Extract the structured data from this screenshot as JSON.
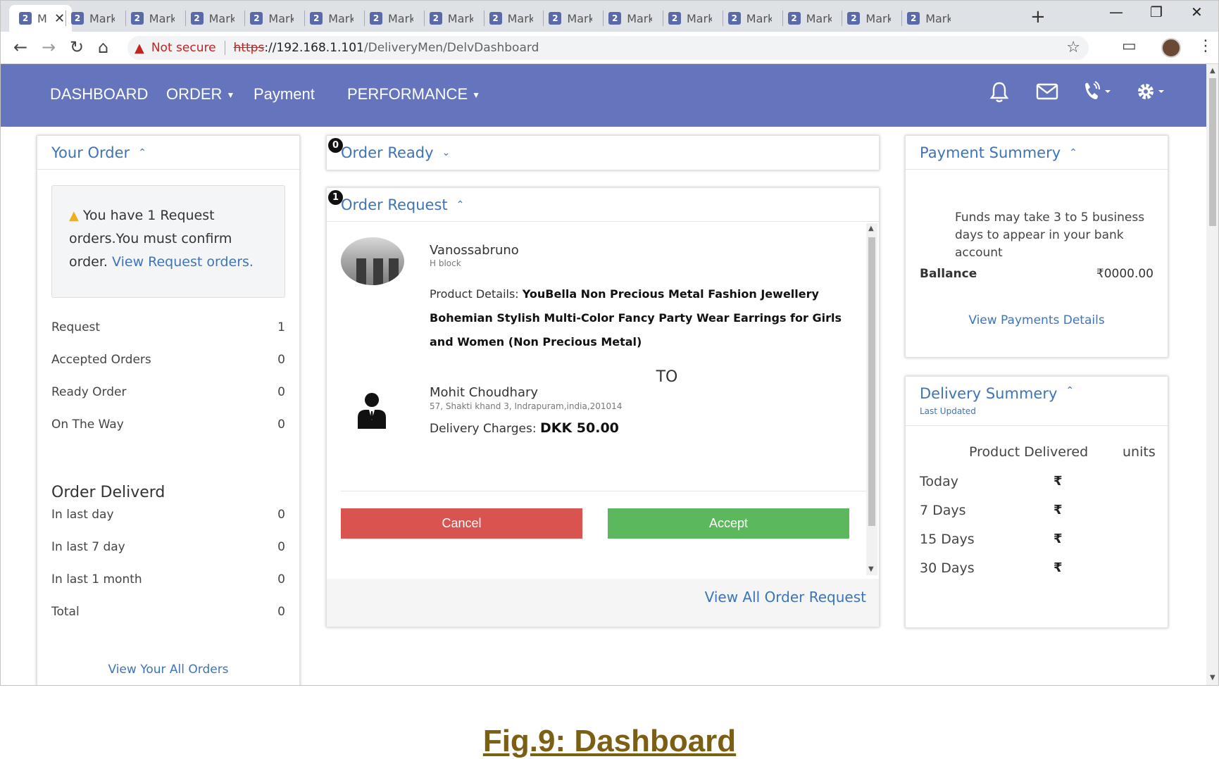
{
  "browser": {
    "active_tab": {
      "title": "M"
    },
    "tabs": [
      "Mark",
      "Mark",
      "Mark",
      "Mark",
      "Mark",
      "Mark",
      "Mark",
      "Mark",
      "Mark",
      "Mark",
      "Mark",
      "Mark",
      "Mark",
      "Mark",
      "Mark"
    ],
    "url": {
      "security_label": "Not secure",
      "scheme": "https",
      "host": "://192.168.1.101",
      "path": "/DeliveryMen/DelvDashboard"
    }
  },
  "nav": {
    "items": [
      {
        "label": "DASHBOARD",
        "dropdown": false
      },
      {
        "label": "ORDER",
        "dropdown": true
      },
      {
        "label": "Payment",
        "dropdown": false
      },
      {
        "label": "PERFORMANCE",
        "dropdown": true
      }
    ],
    "icons": [
      "bell-icon",
      "mail-icon",
      "phone-ring-icon",
      "gear-icon"
    ]
  },
  "your_order": {
    "title": "Your Order",
    "alert": {
      "text": "You have 1 Request orders.You must confirm order.",
      "link": "View Request orders."
    },
    "stats": [
      {
        "label": "Request",
        "value": "1"
      },
      {
        "label": "Accepted Orders",
        "value": "0"
      },
      {
        "label": "Ready Order",
        "value": "0"
      },
      {
        "label": "On The Way",
        "value": "0"
      }
    ],
    "delivered_title": "Order Deliverd",
    "delivered": [
      {
        "label": "In last day",
        "value": "0"
      },
      {
        "label": "In last 7 day",
        "value": "0"
      },
      {
        "label": "In last 1 month",
        "value": "0"
      },
      {
        "label": "Total",
        "value": "0"
      }
    ],
    "footer_link": "View Your All Orders"
  },
  "order_ready": {
    "badge": "0",
    "title": "Order Ready"
  },
  "order_request": {
    "badge": "1",
    "title": "Order Request",
    "seller": {
      "name": "Vanossabruno",
      "address": "H block"
    },
    "product_label": "Product Details:",
    "product_name": "YouBella Non Precious Metal Fashion Jewellery Bohemian Stylish Multi-Color Fancy Party Wear Earrings for Girls and Women (Non Precious Metal)",
    "to_label": "TO",
    "buyer": {
      "name": "Mohit Choudhary",
      "address": "57, Shakti khand 3, Indrapuram,india,201014"
    },
    "charges_label": "Delivery Charges:",
    "charges_value": "DKK 50.00",
    "cancel_label": "Cancel",
    "accept_label": "Accept",
    "footer_link": "View All Order Request"
  },
  "payment_summary": {
    "title": "Payment Summery",
    "note": "Funds may take 3 to 5 business days to appear in your bank account",
    "balance_label": "Ballance",
    "balance_value": "₹0000.00",
    "footer_link": "View Payments Details"
  },
  "delivery_summary": {
    "title": "Delivery Summery",
    "subtitle": "Last Updated",
    "col_product": "Product Delivered",
    "col_units": "units",
    "rows": [
      {
        "label": "Today",
        "symbol": "₹"
      },
      {
        "label": "7 Days",
        "symbol": "₹"
      },
      {
        "label": "15 Days",
        "symbol": "₹"
      },
      {
        "label": "30 Days",
        "symbol": "₹"
      }
    ]
  },
  "caption": "Fig.9: Dashboard",
  "colors": {
    "navbar": "#6575bd",
    "link": "#3d74b8",
    "cancel": "#d9534f",
    "accept": "#5cb85c",
    "caption": "#7b5f12"
  }
}
